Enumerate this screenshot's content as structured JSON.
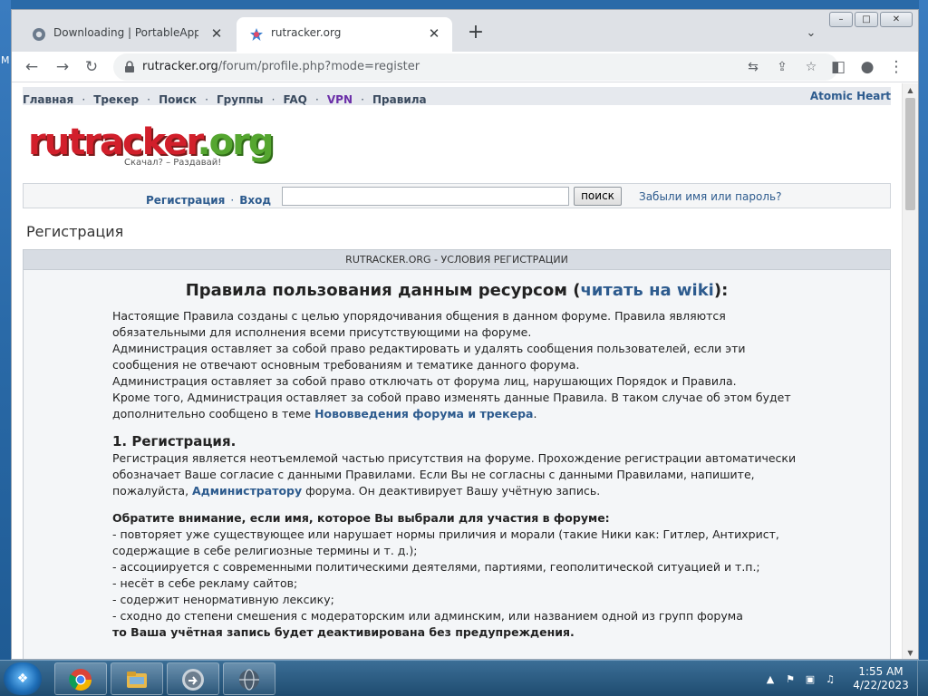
{
  "desktop": {
    "left_label": "M"
  },
  "browser": {
    "tabs": [
      {
        "title": "Downloading | PortableApps.com",
        "close": "✕",
        "active": false
      },
      {
        "title": "rutracker.org",
        "close": "✕",
        "active": true
      }
    ],
    "new_tab": "+",
    "tab_search": "⌄",
    "window_buttons": {
      "minimize": "–",
      "maximize": "□",
      "close": "✕"
    },
    "nav_buttons": {
      "back": "←",
      "forward": "→",
      "reload": "↻"
    },
    "url": {
      "host": "rutracker.org",
      "path": "/forum/profile.php?mode=register"
    },
    "omni_icons": {
      "translate": "⇆",
      "share": "⇪",
      "bookmark": "☆"
    },
    "toolbar_icons": {
      "sidepanel": "◧",
      "profile": "●",
      "menu": "⋮"
    }
  },
  "site": {
    "nav": {
      "links": [
        "Главная",
        "Трекер",
        "Поиск",
        "Группы",
        "FAQ",
        "VPN",
        "Правила"
      ],
      "separator": "·",
      "right": "Atomic Heart"
    },
    "logo": {
      "part1": "rutracker",
      "part2": ".org",
      "tagline": "Скачал? – Раздавай!"
    },
    "login": {
      "register": "Регистрация",
      "login": "Вход",
      "separator": "·",
      "search_value": "",
      "search_button": "поиск",
      "forgot": "Забыли имя или пароль?"
    },
    "page_title": "Регистрация",
    "rules": {
      "header": "RUTRACKER.ORG - УСЛОВИЯ РЕГИСТРАЦИИ",
      "title_prefix": "Правила пользования данным ресурсом (",
      "title_link": "читать на wiki",
      "title_suffix": "):",
      "p1": "Настоящие Правила созданы с целью упорядочивания общения в данном форуме. Правила являются обязательными для исполнения всеми присутствующими на форуме.",
      "p2": "Администрация оставляет за собой право редактировать и удалять сообщения пользователей, если эти сообщения не отвечают основным требованиям и тематике данного форума.",
      "p3": "Администрация оставляет за собой право отключать от форума лиц, нарушающих Порядок и Правила.",
      "p4_prefix": "Кроме того, Администрация оставляет за собой право изменять данные Правила. В таком случае об этом будет дополнительно сообщено в теме ",
      "p4_link": "Нововведения форума и трекера",
      "p4_suffix": ".",
      "s1_title": "1. Регистрация.",
      "s1_text_prefix": "Регистрация является неотъемлемой частью присутствия на форуме. Прохождение регистрации автоматически обозначает Ваше согласие с данными Правилами. Если Вы не согласны с данными Правилами, напишите, пожалуйста, ",
      "s1_link": "Администратору",
      "s1_text_suffix": " форума. Он деактивирует Вашу учётную запись.",
      "note_title": "Обратите внимание, если имя, которое Вы выбрали для участия в форуме:",
      "note_items": [
        "- повторяет уже существующее или нарушает нормы приличия и морали (такие Ники как: Гитлер, Антихрист, содержащие в себе религиозные термины и т. д.);",
        "- ассоциируется с современными политическими деятелями, партиями, геополитической ситуацией и т.п.;",
        "- несёт в себе рекламу сайтов;",
        "- содержит ненормативную лексику;",
        "- сходно до степени смешения с модераторским или админским, или названием одной из групп форума"
      ],
      "note_conclusion": "то Ваша учётная запись будет деактивирована без предупреждения."
    }
  },
  "taskbar": {
    "tray_icons": [
      "▲",
      "⚑",
      "▣",
      "♫"
    ],
    "clock_time": "1:55 AM",
    "clock_date": "4/22/2023"
  },
  "colors": {
    "link": "#2d5b8e",
    "vpn": "#6b2fa8",
    "logo_red": "#d21f2b",
    "logo_green": "#55a630"
  }
}
